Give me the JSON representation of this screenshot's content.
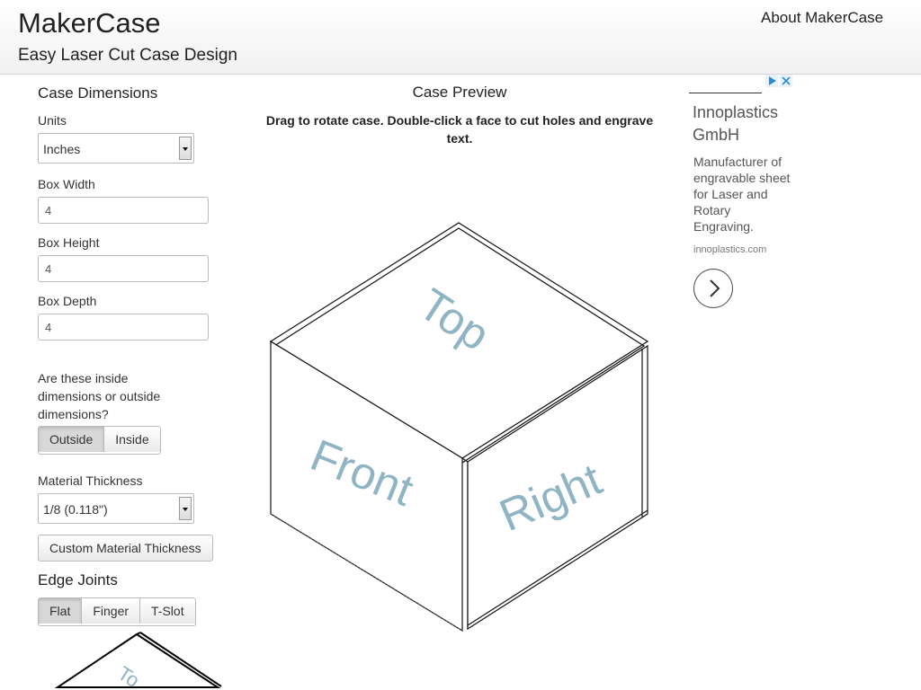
{
  "header": {
    "title": "MakerCase",
    "subtitle": "Easy Laser Cut Case Design",
    "about_link": "About MakerCase"
  },
  "sidebar": {
    "section_title": "Case Dimensions",
    "units": {
      "label": "Units",
      "value": "Inches"
    },
    "box_width": {
      "label": "Box Width",
      "value": "4"
    },
    "box_height": {
      "label": "Box Height",
      "value": "4"
    },
    "box_depth": {
      "label": "Box Depth",
      "value": "4"
    },
    "dimensions_question": "Are these inside dimensions or outside dimensions?",
    "dimension_options": [
      "Outside",
      "Inside"
    ],
    "dimension_selected": "Outside",
    "material_thickness": {
      "label": "Material Thickness",
      "value": "1/8 (0.118\")"
    },
    "custom_thickness_button": "Custom Material Thickness",
    "edge_joints_title": "Edge Joints",
    "edge_joint_options": [
      "Flat",
      "Finger",
      "T-Slot"
    ],
    "edge_joint_selected": "Flat",
    "thumbnail_face_label": "To"
  },
  "preview": {
    "title": "Case Preview",
    "instructions": "Drag to rotate case. Double-click a face to cut holes and engrave text.",
    "faces": {
      "top": "Top",
      "front": "Front",
      "right": "Right"
    },
    "face_label_color": "#8fb4c4"
  },
  "ad": {
    "title": "Innoplastics GmbH",
    "description": "Manufacturer of engravable sheet for Laser and Rotary Engraving.",
    "url": "innoplastics.com",
    "badge_color": "#2a8dd4"
  }
}
